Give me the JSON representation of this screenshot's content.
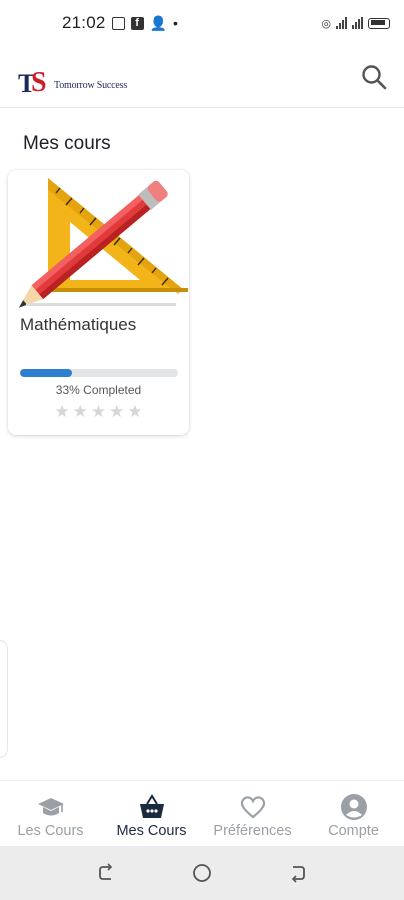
{
  "status_bar": {
    "time": "21:02"
  },
  "app": {
    "logo_letters": {
      "t": "T",
      "s": "S"
    },
    "logo_text": "Tomorrow Success",
    "icons": {
      "search": "search-icon"
    }
  },
  "section": {
    "title": "Mes cours"
  },
  "courses": [
    {
      "title": "Mathématiques",
      "progress_label": "33% Completed",
      "progress_percent": 33,
      "rating": 0,
      "thumbnail": "ruler-pencil-icon",
      "colors": {
        "progress_fill": "#2f7fd0",
        "progress_track": "#e2e4e6",
        "star_empty": "#d6d6d6"
      }
    }
  ],
  "bottom_nav": {
    "items": [
      {
        "label": "Les Cours",
        "icon": "graduation-cap-icon",
        "active": false
      },
      {
        "label": "Mes Cours",
        "icon": "basket-icon",
        "active": true
      },
      {
        "label": "Préférences",
        "icon": "heart-icon",
        "active": false
      },
      {
        "label": "Compte",
        "icon": "account-icon",
        "active": false
      }
    ],
    "colors": {
      "active": "#1c2a40",
      "inactive": "#9aa0a6"
    }
  },
  "system_nav": {
    "buttons": [
      "recent-apps-icon",
      "home-icon",
      "back-icon"
    ]
  }
}
